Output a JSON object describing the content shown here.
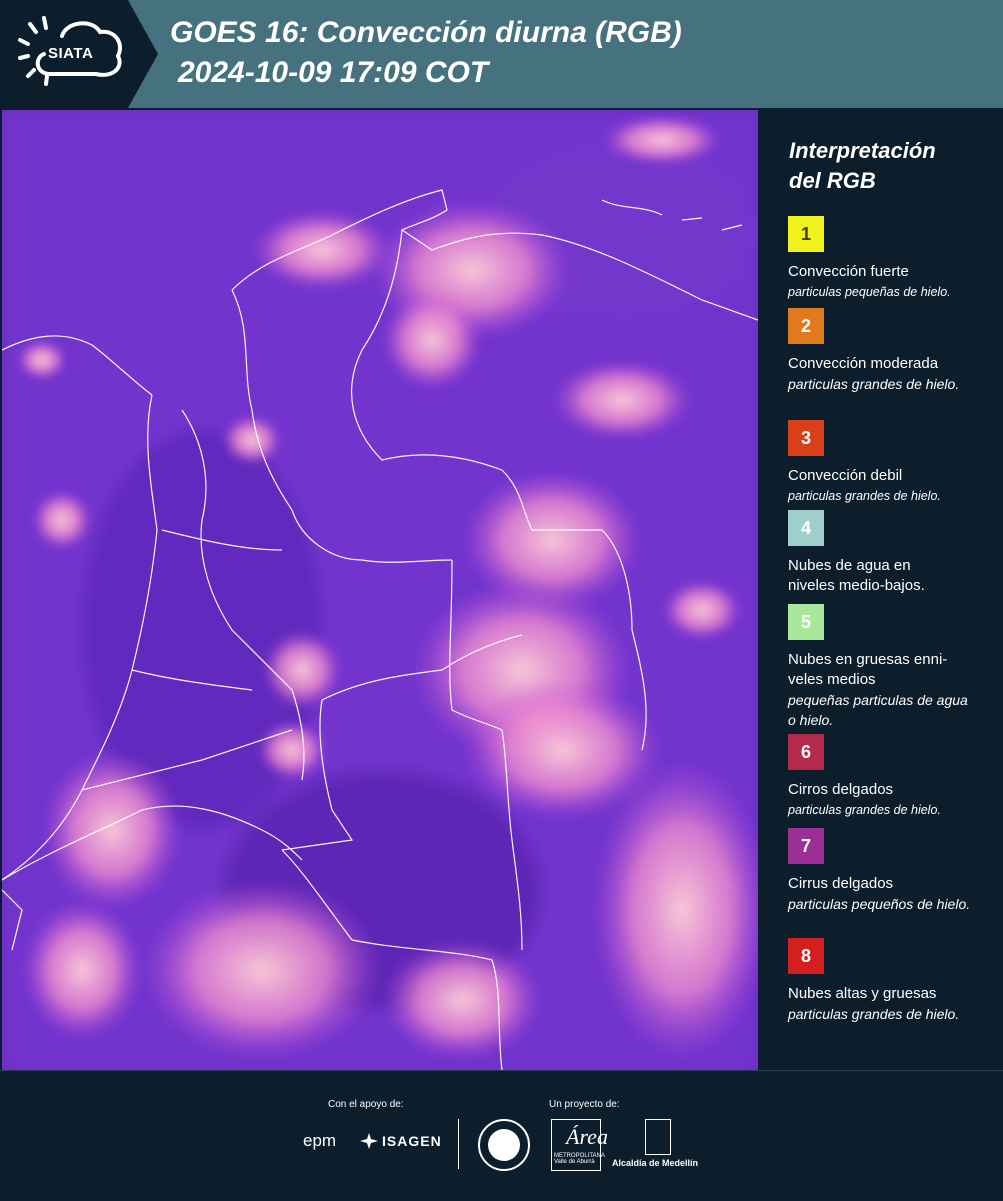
{
  "header": {
    "logo_text": "SIATA",
    "title_line1": "GOES 16: Convección diurna (RGB)",
    "title_line2": "2024-10-09 17:09 COT",
    "background": "#46727f"
  },
  "legend": {
    "title_line1": "Interpretación",
    "title_line2": "del RGB",
    "items": [
      {
        "number": "1",
        "color": "#f0f21c",
        "label": "Convección fuerte",
        "sub": "particulas pequeñas de hielo."
      },
      {
        "number": "2",
        "color": "#e07a1c",
        "label": "Convección moderada",
        "sub": "particulas grandes de hielo."
      },
      {
        "number": "3",
        "color": "#d9401a",
        "label": "Convección debil",
        "sub": "particulas grandes de hielo."
      },
      {
        "number": "4",
        "color": "#9fcfcc",
        "label": "Nubes de agua en niveles medio-bajos.",
        "sub": ""
      },
      {
        "number": "5",
        "color": "#a9e79a",
        "label": "Nubes en gruesas enni-veles medios",
        "sub": "pequeñas particulas de agua o hielo."
      },
      {
        "number": "6",
        "color": "#b5294a",
        "label": "Cirros delgados",
        "sub": "particulas grandes de hielo."
      },
      {
        "number": "7",
        "color": "#9c2f96",
        "label": "Cirrus delgados",
        "sub": "particulas pequeños de hielo."
      },
      {
        "number": "8",
        "color": "#d41f1f",
        "label": "Nubes altas y gruesas",
        "sub": "particulas grandes de hielo."
      }
    ]
  },
  "footer": {
    "support_label": "Con el apoyo de:",
    "project_label": "Un proyecto de:",
    "epm": "epm",
    "isagen": "ISAGEN",
    "area_logo": "Área",
    "area_sub": "METROPOLITANA Valle de Aburrá",
    "alcaldia": "Alcaldía de Medellín"
  }
}
